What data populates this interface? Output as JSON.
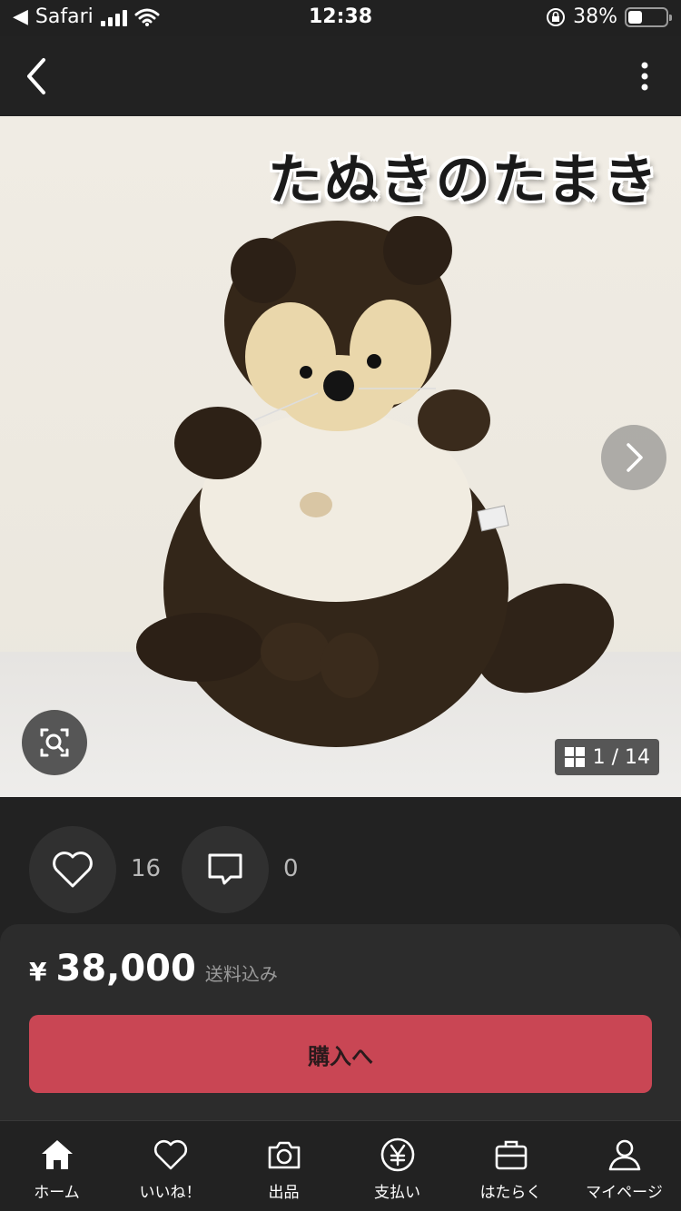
{
  "status_bar": {
    "back_app": "Safari",
    "time": "12:38",
    "battery_percent": "38%",
    "battery_level": 0.38
  },
  "nav": {
    "back_icon": "chevron-left-icon",
    "menu_icon": "more-vertical-icon"
  },
  "hero": {
    "title": "たぬきのたまき",
    "image_counter": "1 / 14",
    "current_image": 1,
    "total_images": 14
  },
  "actions": {
    "like_count": "16",
    "comment_count": "0"
  },
  "purchase": {
    "currency": "¥",
    "price": "38,000",
    "shipping_note": "送料込み",
    "buy_label": "購入へ",
    "button_color": "#c94654"
  },
  "tab_bar": {
    "items": [
      {
        "label": "ホーム",
        "icon": "home-icon"
      },
      {
        "label": "いいね！",
        "icon": "heart-icon"
      },
      {
        "label": "出品",
        "icon": "camera-icon"
      },
      {
        "label": "支払い",
        "icon": "yen-icon"
      },
      {
        "label": "はたらく",
        "icon": "briefcase-icon"
      },
      {
        "label": "マイページ",
        "icon": "user-icon"
      }
    ]
  }
}
